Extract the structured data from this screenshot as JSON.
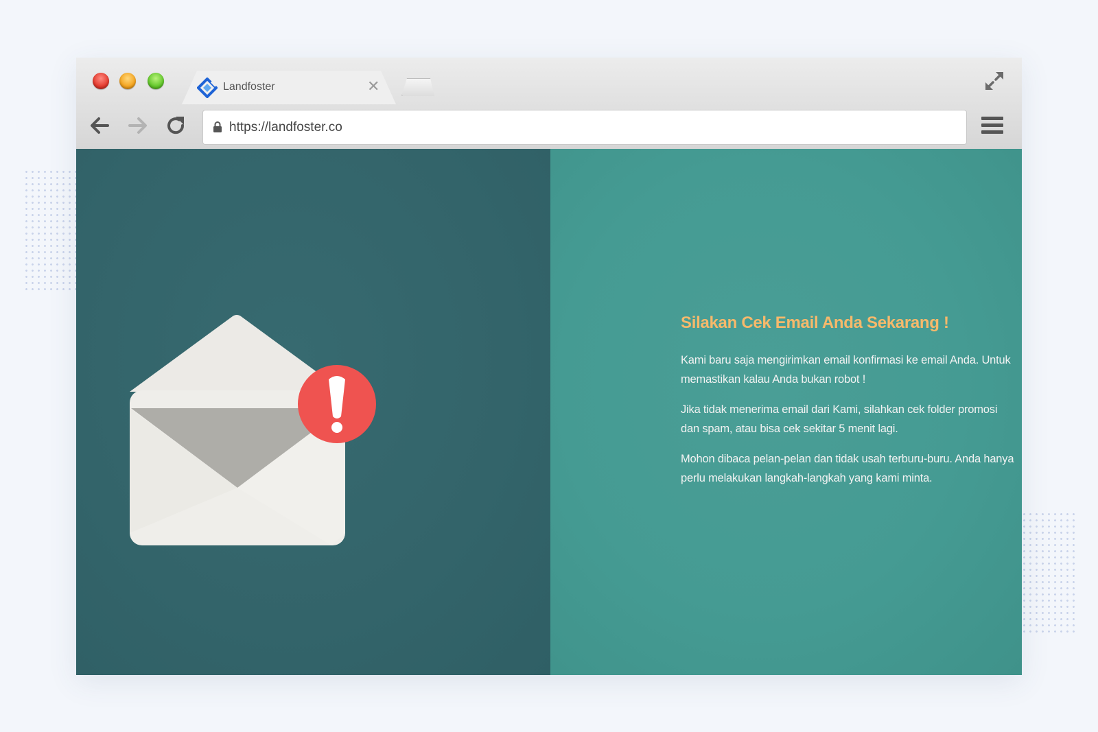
{
  "browser": {
    "tab": {
      "title": "Landfoster",
      "close_glyph": "✕"
    },
    "address_bar": {
      "url": "https://landfoster.co"
    },
    "icons": {
      "traffic_lights": [
        "close-light-icon",
        "minimize-light-icon",
        "zoom-light-icon"
      ],
      "nav": [
        "back-arrow-icon",
        "forward-arrow-icon",
        "reload-icon"
      ],
      "other": [
        "lock-icon",
        "hamburger-menu-icon",
        "fullscreen-resize-icon",
        "landfoster-logo-icon"
      ]
    }
  },
  "page": {
    "headline": "Silakan Cek Email Anda Sekarang !",
    "paragraphs": [
      "Kami baru saja mengirimkan email konfirmasi ke email Anda. Untuk memastikan kalau Anda bukan robot !",
      "Jika tidak menerima email dari Kami, silahkan cek folder promosi dan spam, atau bisa cek sekitar 5 menit lagi.",
      "Mohon dibaca pelan-pelan dan tidak usah terburu-buru. Anda hanya perlu melakukan langkah-langkah yang kami minta."
    ],
    "illustration": "envelope-alert-icon"
  },
  "colors": {
    "left_panel": "#33646a",
    "right_panel": "#459b93",
    "headline": "#f6b96b",
    "alert_badge": "#ef5350",
    "envelope": "#eeede9"
  }
}
